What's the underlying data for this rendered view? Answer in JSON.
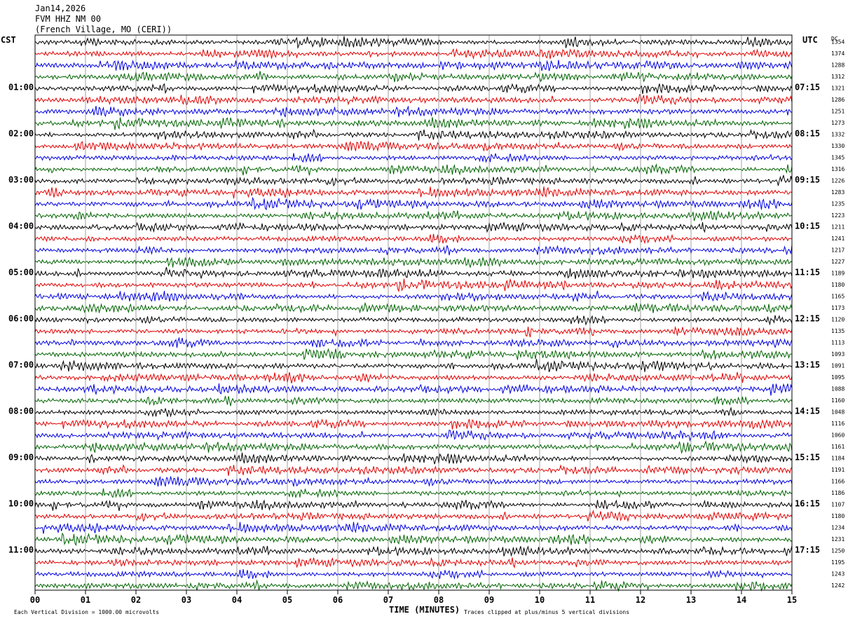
{
  "header": {
    "date": "Jan14,2026",
    "station": "FVM HHZ NM 00",
    "location": "(French Village, MO (CERI))"
  },
  "labels": {
    "left_zone": "CST",
    "right_zone": "UTC",
    "dc": "DC",
    "xlabel": "TIME (MINUTES)"
  },
  "footer": {
    "scale_note": "Each Vertical Division = 1000.00 microvolts",
    "clip_note": "Traces clipped at plus/minus 5 vertical divisions"
  },
  "chart_data": {
    "type": "line",
    "title": "",
    "xlabel": "TIME (MINUTES)",
    "ylabel": "",
    "xlim": [
      0,
      15
    ],
    "x_ticks": [
      "00",
      "01",
      "02",
      "03",
      "04",
      "05",
      "06",
      "07",
      "08",
      "09",
      "10",
      "11",
      "12",
      "13",
      "14",
      "15"
    ],
    "grid": true,
    "legend": "none",
    "trace_colors": [
      "#000000",
      "#e00000",
      "#0000e0",
      "#006400"
    ],
    "left_hour_labels": [
      "01:00",
      "02:00",
      "03:00",
      "04:00",
      "05:00",
      "06:00",
      "07:00",
      "08:00",
      "09:00",
      "10:00",
      "11:00"
    ],
    "right_hour_labels": [
      "07:15",
      "08:15",
      "09:15",
      "10:15",
      "11:15",
      "12:15",
      "13:15",
      "14:15",
      "15:15",
      "16:15",
      "17:15"
    ],
    "dc_offsets": [
      "1354",
      "1374",
      "1288",
      "1312",
      "1321",
      "1286",
      "1251",
      "1273",
      "1332",
      "1330",
      "1345",
      "1316",
      "1226",
      "1283",
      "1235",
      "1223",
      "1211",
      "1241",
      "1217",
      "1227",
      "1189",
      "1180",
      "1165",
      "1173",
      "1120",
      "1135",
      "1113",
      "1093",
      "1091",
      "1095",
      "1088",
      "1160",
      "1048",
      "1116",
      "1060",
      "1161",
      "1184",
      "1191",
      "1166",
      "1186",
      "1107",
      "1180",
      "1234",
      "1231",
      "1250",
      "1195",
      "1243",
      "1242"
    ]
  }
}
